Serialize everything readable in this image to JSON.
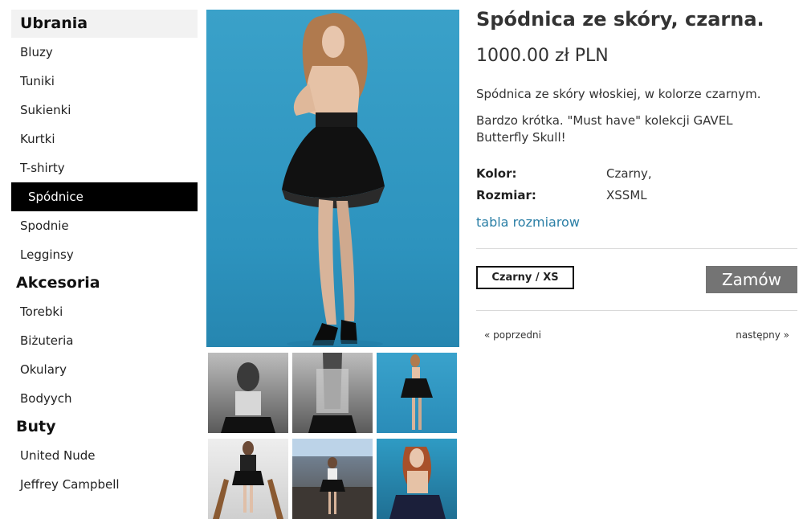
{
  "sidebar": {
    "ubrania": {
      "heading": "Ubrania",
      "items": [
        "Bluzy",
        "Tuniki",
        "Sukienki",
        "Kurtki",
        "T-shirty",
        "Spódnice",
        "Spodnie",
        "Legginsy"
      ]
    },
    "akcesoria": {
      "heading": "Akcesoria",
      "items": [
        "Torebki",
        "Biżuteria",
        "Okulary",
        "Bodyych"
      ]
    },
    "buty": {
      "heading": "Buty",
      "items": [
        "United Nude",
        "Jeffrey Campbell"
      ]
    },
    "active_item": "Spódnice"
  },
  "product": {
    "title": "Spódnica ze skóry, czarna.",
    "price": "1000.00 zł PLN",
    "description_1": "Spódnica ze skóry włoskiej, w kolorze czarnym.",
    "description_2": "Bardzo krótka. \"Must have\" kolekcji GAVEL Butterfly Skull!",
    "color_label": "Kolor:",
    "color_value": "Czarny,",
    "size_label": "Rozmiar:",
    "size_value": "XSSML",
    "size_table_link": "tabla rozmiarow",
    "selected_variant": "Czarny / XS",
    "order_button": "Zamów"
  },
  "pager": {
    "prev": "« poprzedni",
    "next": "następny »"
  },
  "colors": {
    "active_bg": "#000000",
    "order_button": "#747474",
    "link": "#2b7fa6",
    "photo_bg": "#2d93be"
  }
}
